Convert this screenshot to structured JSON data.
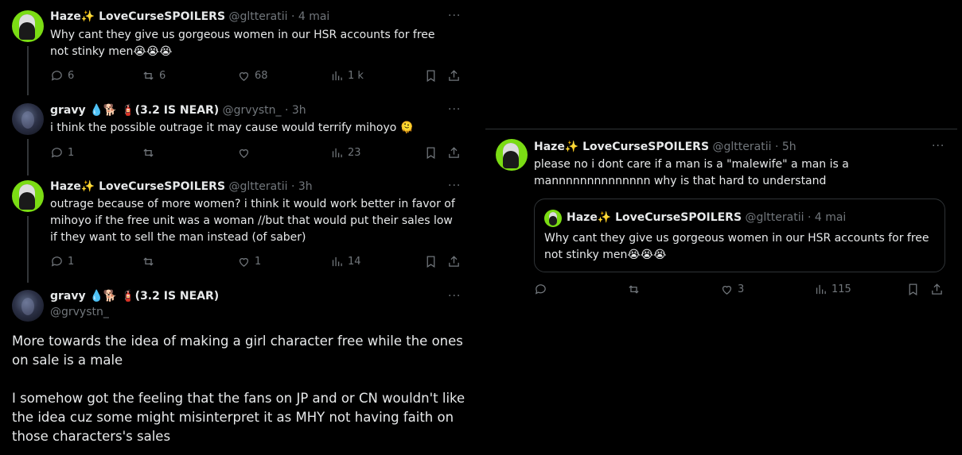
{
  "left": {
    "tweets": [
      {
        "name": "Haze✨ LoveCurseSPOILERS",
        "handle": "@gltteratii",
        "time": "· 4 mai",
        "text": "Why cant they give us gorgeous women in our HSR accounts for free not stinky men😭😭😭",
        "replies": "6",
        "retweets": "6",
        "likes": "68",
        "views": "1 k"
      },
      {
        "name": "gravy 💧🐕 🧯(3.2 IS NEAR)",
        "handle": "@grvystn_",
        "time": "· 3h",
        "text": "i think the possible outrage it may cause would terrify mihoyo 🫠",
        "replies": "1",
        "retweets": "",
        "likes": "",
        "views": "23"
      },
      {
        "name": "Haze✨ LoveCurseSPOILERS",
        "handle": "@gltteratii",
        "time": "· 3h",
        "text": "outrage because of more women? i think it would work better in favor of mihoyo if the free unit was a woman //but that would put their sales low if they want to sell the man instead (of saber)",
        "replies": "1",
        "retweets": "",
        "likes": "1",
        "views": "14"
      }
    ],
    "main": {
      "name": "gravy 💧🐕 🧯(3.2 IS NEAR)",
      "handle": "@grvystn_",
      "text": "More towards the idea of making a girl character free while the ones on sale is a male\n\nI somehow got the feeling that the fans on JP and or CN wouldn't like the idea cuz some might misinterpret it as MHY not having faith on those characters's sales"
    }
  },
  "right": {
    "tweet": {
      "name": "Haze✨ LoveCurseSPOILERS",
      "handle": "@gltteratii",
      "time": "· 5h",
      "text": "please no i dont care if a man is a \"malewife\" a man is a mannnnnnnnnnnnnn why is that hard to understand",
      "replies": "",
      "retweets": "",
      "likes": "3",
      "views": "115"
    },
    "quote": {
      "name": "Haze✨ LoveCurseSPOILERS",
      "handle": "@gltteratii",
      "time": "· 4 mai",
      "text": "Why cant they give us gorgeous women in our HSR accounts for free not stinky men😭😭😭"
    }
  },
  "more_label": "···",
  "icons": [
    "reply-icon",
    "retweet-icon",
    "like-icon",
    "views-icon",
    "bookmark-icon",
    "share-icon"
  ],
  "colors": {
    "background": "#000000",
    "text": "#e7e9ea",
    "muted": "#71767b",
    "border": "#2f3336",
    "avatar_green": "#7bdc14"
  }
}
